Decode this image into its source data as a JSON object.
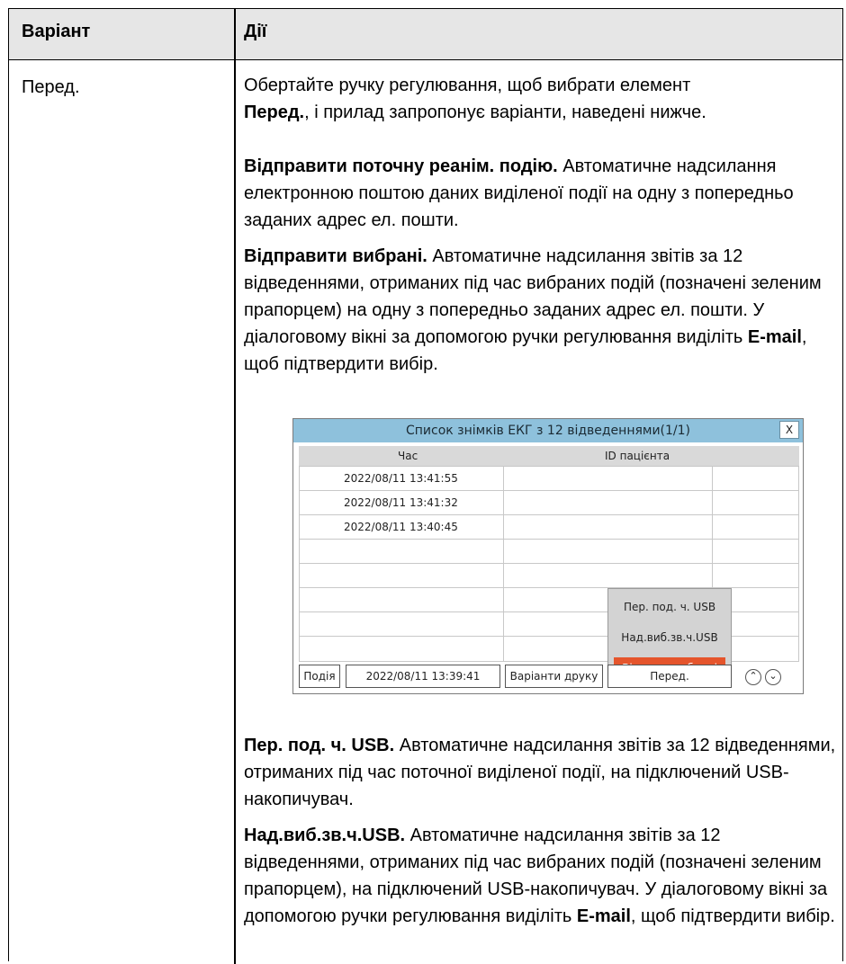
{
  "table": {
    "header_variant": "Варіант",
    "header_actions": "Дії",
    "variant": "Перед."
  },
  "actions": {
    "intro_1": "Обертайте ручку регулювання, щоб вибрати елемент",
    "intro_bold": "Перед.",
    "intro_2": ", і прилад запропонує варіанти, наведені нижче.",
    "send_current_bold": "Відправити поточну реанім. подію.",
    "send_current_text": " Автоматичне надсилання електронною поштою даних виділеної події на одну з попередньо заданих адрес ел. пошти.",
    "send_selected_bold": "Відправити вибрані.",
    "send_selected_text_1": " Автоматичне надсилання звітів за 12 відведеннями, отриманих під час вибраних подій (позначені зеленим прапорцем) на одну з попередньо заданих адрес ел. пошти. У діалоговому вікні за допомогою ручки регулювання виділіть ",
    "send_selected_email": "E-mail",
    "send_selected_text_2": ", щоб підтвердити вибір.",
    "usb_current_bold": "Пер. под. ч. USB.",
    "usb_current_text": " Автоматичне надсилання звітів за 12 відведеннями, отриманих під час поточної виділеної події, на підключений USB-накопичувач.",
    "usb_selected_bold": "Над.виб.зв.ч.USB.",
    "usb_selected_text_1": " Автоматичне надсилання звітів за 12 відведеннями, отриманих під час вибраних подій (позначені зеленим прапорцем), на підключений USB-накопичувач. У діалоговому вікні за допомогою ручки регулювання виділіть ",
    "usb_selected_email": "E-mail",
    "usb_selected_text_2": ", щоб підтвердити вибір."
  },
  "screenshot": {
    "title": "Список знімків ЕКГ з 12 відведеннями(1/1)",
    "close": "X",
    "col_time": "Час",
    "col_patient": "ID пацієнта",
    "rows": [
      "2022/08/11 13:41:55",
      "2022/08/11 13:41:32",
      "2022/08/11 13:40:45"
    ],
    "popup": [
      "Пер. под. ч. USB",
      "Над.виб.зв.ч.USB",
      "Відправ. вибрані"
    ],
    "popup_selected_color": "#e5552c",
    "title_bar_color": "#8ec1dc",
    "event_label": "Подія",
    "event_time": "2022/08/11 13:39:41",
    "print_options": "Варіанти друку",
    "forward": "Перед.",
    "up_icon": "chevron-up-icon",
    "down_icon": "chevron-down-icon"
  }
}
